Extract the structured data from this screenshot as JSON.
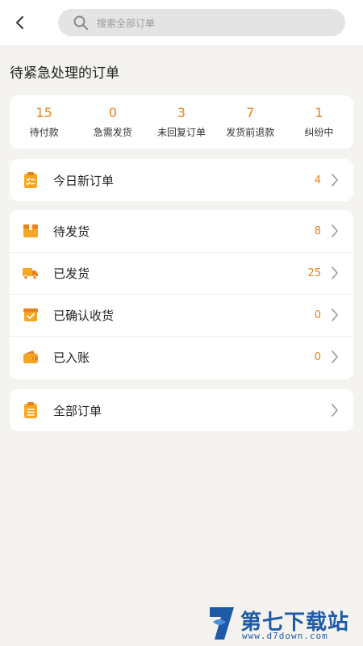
{
  "header": {
    "back_icon": "chevron-left-icon",
    "search": {
      "icon": "search-icon",
      "placeholder": "搜索全部订单"
    }
  },
  "section_title": "待紧急处理的订单",
  "stats": [
    {
      "value": "15",
      "label": "待付款"
    },
    {
      "value": "0",
      "label": "急需发货"
    },
    {
      "value": "3",
      "label": "未回复订单"
    },
    {
      "value": "7",
      "label": "发货前退款"
    },
    {
      "value": "1",
      "label": "纠纷中"
    }
  ],
  "today": {
    "icon": "clipboard-check-icon",
    "label": "今日新订单",
    "count": "4"
  },
  "status_items": [
    {
      "icon": "package-icon",
      "label": "待发货",
      "count": "8"
    },
    {
      "icon": "truck-icon",
      "label": "已发货",
      "count": "25"
    },
    {
      "icon": "box-check-icon",
      "label": "已确认收货",
      "count": "0"
    },
    {
      "icon": "wallet-icon",
      "label": "已入账",
      "count": "0"
    }
  ],
  "all_orders": {
    "icon": "clipboard-list-icon",
    "label": "全部订单"
  },
  "watermark": {
    "name": "第七下载站",
    "url": "www.d7down.com"
  },
  "colors": {
    "accent": "#e8811c",
    "icon": "#f5a623",
    "background": "#f4f3ef",
    "watermark": "#1e5aa8"
  }
}
